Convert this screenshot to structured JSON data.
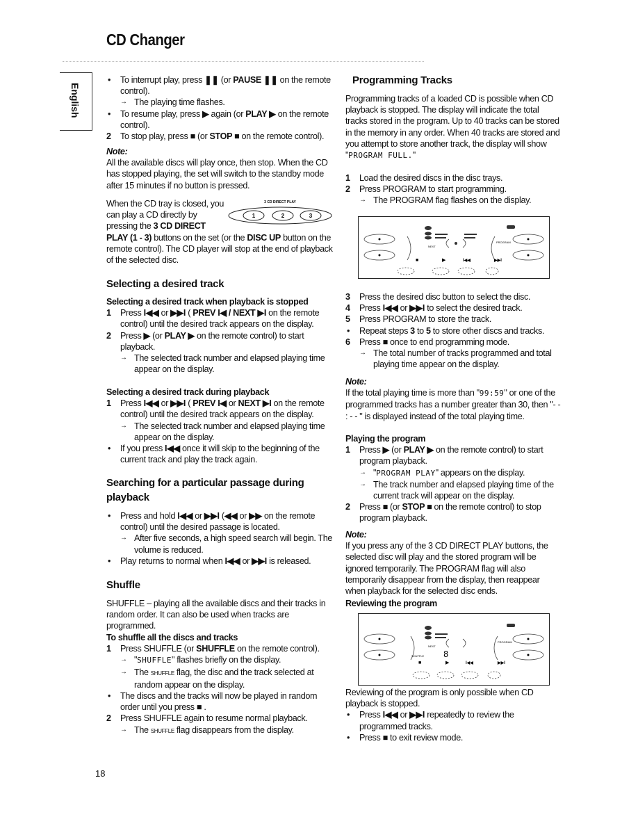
{
  "header": {
    "title": "CD Changer",
    "language_tab": "English"
  },
  "page_number": "18",
  "direct_play_diagram": {
    "label": "3 CD DIRECT PLAY",
    "buttons": [
      "1",
      "2",
      "3"
    ]
  },
  "left": [
    [
      {
        "t": "bullet",
        "s": [
          "To interrupt play, press ",
          [
            "❚❚",
            "b"
          ],
          " (or ",
          [
            "PAUSE ❚❚",
            "b"
          ],
          " on the remote control)."
        ]
      },
      {
        "t": "arrow",
        "s": [
          "The playing time flashes."
        ]
      },
      {
        "t": "bullet",
        "s": [
          "To resume play, press ",
          [
            "▶",
            "b"
          ],
          " again (or ",
          [
            "PLAY ▶",
            "b"
          ],
          " on the remote control)."
        ]
      },
      {
        "t": "num",
        "n": "2",
        "s": [
          "To stop play, press ",
          [
            "■",
            "b"
          ],
          " (or ",
          [
            "STOP ■",
            "b"
          ],
          " on the remote control)."
        ]
      }
    ],
    [
      {
        "t": "note",
        "s": [
          "Note:"
        ]
      },
      {
        "t": "p",
        "s": [
          "All the available discs will play once,  then stop. When the CD has stopped playing, the set will switch to the standby mode after 15 minutes if no button is pressed."
        ]
      }
    ],
    [
      {
        "t": "p",
        "s": [
          "When the CD tray is closed, you",
          [
            "\n"
          ],
          "can play a CD directly by",
          [
            "\n"
          ],
          "pressing the ",
          [
            "3 CD DIRECT",
            "b"
          ],
          [
            "\n"
          ],
          [
            "PLAY (1 - 3)",
            "b"
          ],
          " buttons on the set (or the ",
          [
            "DISC UP",
            "b"
          ],
          " button on the remote control). The CD player will stop at the end of playback of the selected disc."
        ]
      }
    ],
    [
      {
        "t": "h2",
        "s": [
          "Selecting a desired track"
        ]
      }
    ],
    [
      {
        "t": "h3",
        "s": [
          "Selecting a desired track when playback is stopped"
        ]
      },
      {
        "t": "num",
        "n": "1",
        "s": [
          "Press ",
          [
            "I◀◀",
            "b"
          ],
          " or ",
          [
            "▶▶I",
            "b"
          ],
          " ( ",
          [
            "PREV I◀ / NEXT ▶I",
            "b"
          ],
          " on the remote control) until the desired track appears on the display."
        ]
      },
      {
        "t": "num",
        "n": "2",
        "s": [
          "Press ",
          [
            "▶",
            "b"
          ],
          " (or ",
          [
            "PLAY ▶",
            "b"
          ],
          " on the remote control) to start playback."
        ]
      },
      {
        "t": "arrow",
        "s": [
          "The selected track number and elapsed playing time appear on the display."
        ]
      }
    ],
    [
      {
        "t": "h3",
        "s": [
          "Selecting a desired track during playback"
        ]
      },
      {
        "t": "num",
        "n": "1",
        "s": [
          "Press ",
          [
            "I◀◀",
            "b"
          ],
          " or ",
          [
            "▶▶I",
            "b"
          ],
          " ( ",
          [
            "PREV I◀",
            "b"
          ],
          " or ",
          [
            "NEXT ▶I",
            "b"
          ],
          " on the remote control) until the desired track appears on the display."
        ]
      },
      {
        "t": "arrow",
        "s": [
          "The selected track number and elapsed playing time appear on the display."
        ]
      },
      {
        "t": "bullet",
        "s": [
          "If you press ",
          [
            "I◀◀",
            "b"
          ],
          " once it will skip to the beginning of the current track and play the track again."
        ]
      }
    ],
    [
      {
        "t": "h2",
        "s": [
          "Searching for a particular passage during playback"
        ]
      }
    ],
    [
      {
        "t": "bullet",
        "s": [
          "Press and hold ",
          [
            "I◀◀",
            "b"
          ],
          " or ",
          [
            "▶▶I",
            "b"
          ],
          " (",
          [
            "◀◀",
            "b"
          ],
          " or ",
          [
            "▶▶",
            "b"
          ],
          " on the remote control) until the desired passage is located."
        ]
      },
      {
        "t": "arrow",
        "s": [
          "After five seconds, a high speed search will begin. The volume is reduced."
        ]
      },
      {
        "t": "bullet",
        "s": [
          "Play returns to normal when ",
          [
            "I◀◀",
            "b"
          ],
          " or ",
          [
            "▶▶I",
            "b"
          ],
          " is released."
        ]
      }
    ],
    [
      {
        "t": "h2",
        "s": [
          "Shuffle"
        ]
      }
    ],
    [
      {
        "t": "p",
        "s": [
          "SHUFFLE – playing all the available discs and their tracks in random order. It can also be used when tracks are programmed."
        ]
      }
    ],
    [
      {
        "t": "h3",
        "s": [
          "To shuffle all the discs and tracks"
        ]
      },
      {
        "t": "num",
        "n": "1",
        "s": [
          "Press SHUFFLE (or ",
          [
            "SHUFFLE",
            "b"
          ],
          " on the remote control)."
        ]
      },
      {
        "t": "arrow",
        "s": [
          "\"",
          [
            "SHUFFLE",
            "m"
          ],
          "\" flashes briefly on the display."
        ]
      },
      {
        "t": "arrow",
        "s": [
          "The ",
          [
            "shuffle",
            "sc"
          ],
          " flag, the disc and the track selected at random appear on the display."
        ]
      },
      {
        "t": "bullet",
        "s": [
          "The discs and the tracks will now be played in random order until you press ",
          [
            "■",
            "b"
          ],
          " ."
        ]
      },
      {
        "t": "num",
        "n": "2",
        "s": [
          "Press SHUFFLE again to resume normal playback."
        ]
      },
      {
        "t": "arrow",
        "s": [
          "The ",
          [
            "shuffle",
            "sc"
          ],
          " flag disappears from the display."
        ]
      }
    ]
  ],
  "right": [
    [
      {
        "t": "h2",
        "s": [
          "Programming Tracks"
        ]
      }
    ],
    [
      {
        "t": "p",
        "s": [
          "Programming tracks of a loaded CD is possible when CD playback is stopped. The display will indicate the total tracks stored in the program. Up to 40 tracks can be stored in the memory in any order. When 40 tracks are stored and you attempt to store another track, the display will show \"",
          [
            "PROGRAM FULL.",
            "m"
          ],
          "\""
        ]
      }
    ],
    [
      {
        "t": "num",
        "n": "1",
        "s": [
          "Load the desired discs in the disc trays."
        ]
      },
      {
        "t": "num",
        "n": "2",
        "s": [
          "Press PROGRAM to start programming."
        ]
      },
      {
        "t": "arrow",
        "s": [
          "The PROGRAM flag flashes on the display."
        ]
      }
    ],
    [
      {
        "t": "num",
        "n": "3",
        "s": [
          "Press the desired disc button to select the disc."
        ]
      },
      {
        "t": "num",
        "n": "4",
        "s": [
          "Press ",
          [
            "I◀◀",
            "b"
          ],
          " or ",
          [
            "▶▶I",
            "b"
          ],
          " to select the desired track."
        ]
      },
      {
        "t": "num",
        "n": "5",
        "s": [
          "Press PROGRAM to store the track."
        ]
      },
      {
        "t": "bullet",
        "s": [
          "Repeat steps ",
          [
            "3",
            "b"
          ],
          " to ",
          [
            "5",
            "b"
          ],
          " to store other discs and tracks."
        ]
      },
      {
        "t": "num",
        "n": "6",
        "s": [
          "Press ",
          [
            "■",
            "b"
          ],
          " once to end programming mode."
        ]
      },
      {
        "t": "arrow",
        "s": [
          "The total number of tracks programmed and total playing time appear on the display."
        ]
      }
    ],
    [
      {
        "t": "note",
        "s": [
          "Note:"
        ]
      },
      {
        "t": "p",
        "s": [
          "If the total playing time is more than \"",
          [
            "99:59",
            "m"
          ],
          "\" or one of the programmed tracks has  a number greater than 30, then \"- - : - - \" is displayed instead of the total playing time."
        ]
      }
    ],
    [
      {
        "t": "h3",
        "s": [
          "Playing the program"
        ]
      },
      {
        "t": "num",
        "n": "1",
        "s": [
          "Press ",
          [
            "▶",
            "b"
          ],
          " (or ",
          [
            "PLAY ▶",
            "b"
          ],
          " on the remote control) to start program playback."
        ]
      },
      {
        "t": "arrow",
        "s": [
          "\"",
          [
            "PROGRAM PLAY",
            "m"
          ],
          "\" appears on the display."
        ]
      },
      {
        "t": "arrow",
        "s": [
          "The track number and elapsed playing time of the current track will appear on the display."
        ]
      },
      {
        "t": "num",
        "n": "2",
        "s": [
          "Press ",
          [
            "■",
            "b"
          ],
          " (or ",
          [
            "STOP ■",
            "b"
          ],
          " on the remote control) to stop program playback."
        ]
      }
    ],
    [
      {
        "t": "note",
        "s": [
          "Note:"
        ]
      },
      {
        "t": "p",
        "s": [
          "If you press any of the 3 CD DIRECT PLAY buttons, the selected disc will play and the stored program will be ignored temporarily. The PROGRAM flag will also temporarily disappear from the display, then reappear when playback for the selected disc ends."
        ]
      }
    ],
    [
      {
        "t": "h3",
        "s": [
          "Reviewing the program"
        ]
      }
    ],
    [
      {
        "t": "p",
        "s": [
          "Reviewing of the program is only possible when CD playback is stopped."
        ]
      },
      {
        "t": "bullet",
        "s": [
          "Press ",
          [
            "I◀◀",
            "b"
          ],
          " or ",
          [
            "▶▶I",
            "b"
          ],
          " repeatedly to review the programmed tracks."
        ]
      },
      {
        "t": "bullet",
        "s": [
          "Press ",
          [
            "■",
            "b"
          ],
          " to exit review mode."
        ]
      }
    ]
  ],
  "displays": [
    {
      "track_digit": "",
      "labels": [
        "NEXT",
        "PROGRAM"
      ]
    },
    {
      "track_digit": "8",
      "labels": [
        "NEXT",
        "SHUFFLE",
        "PROGRAM"
      ]
    }
  ]
}
